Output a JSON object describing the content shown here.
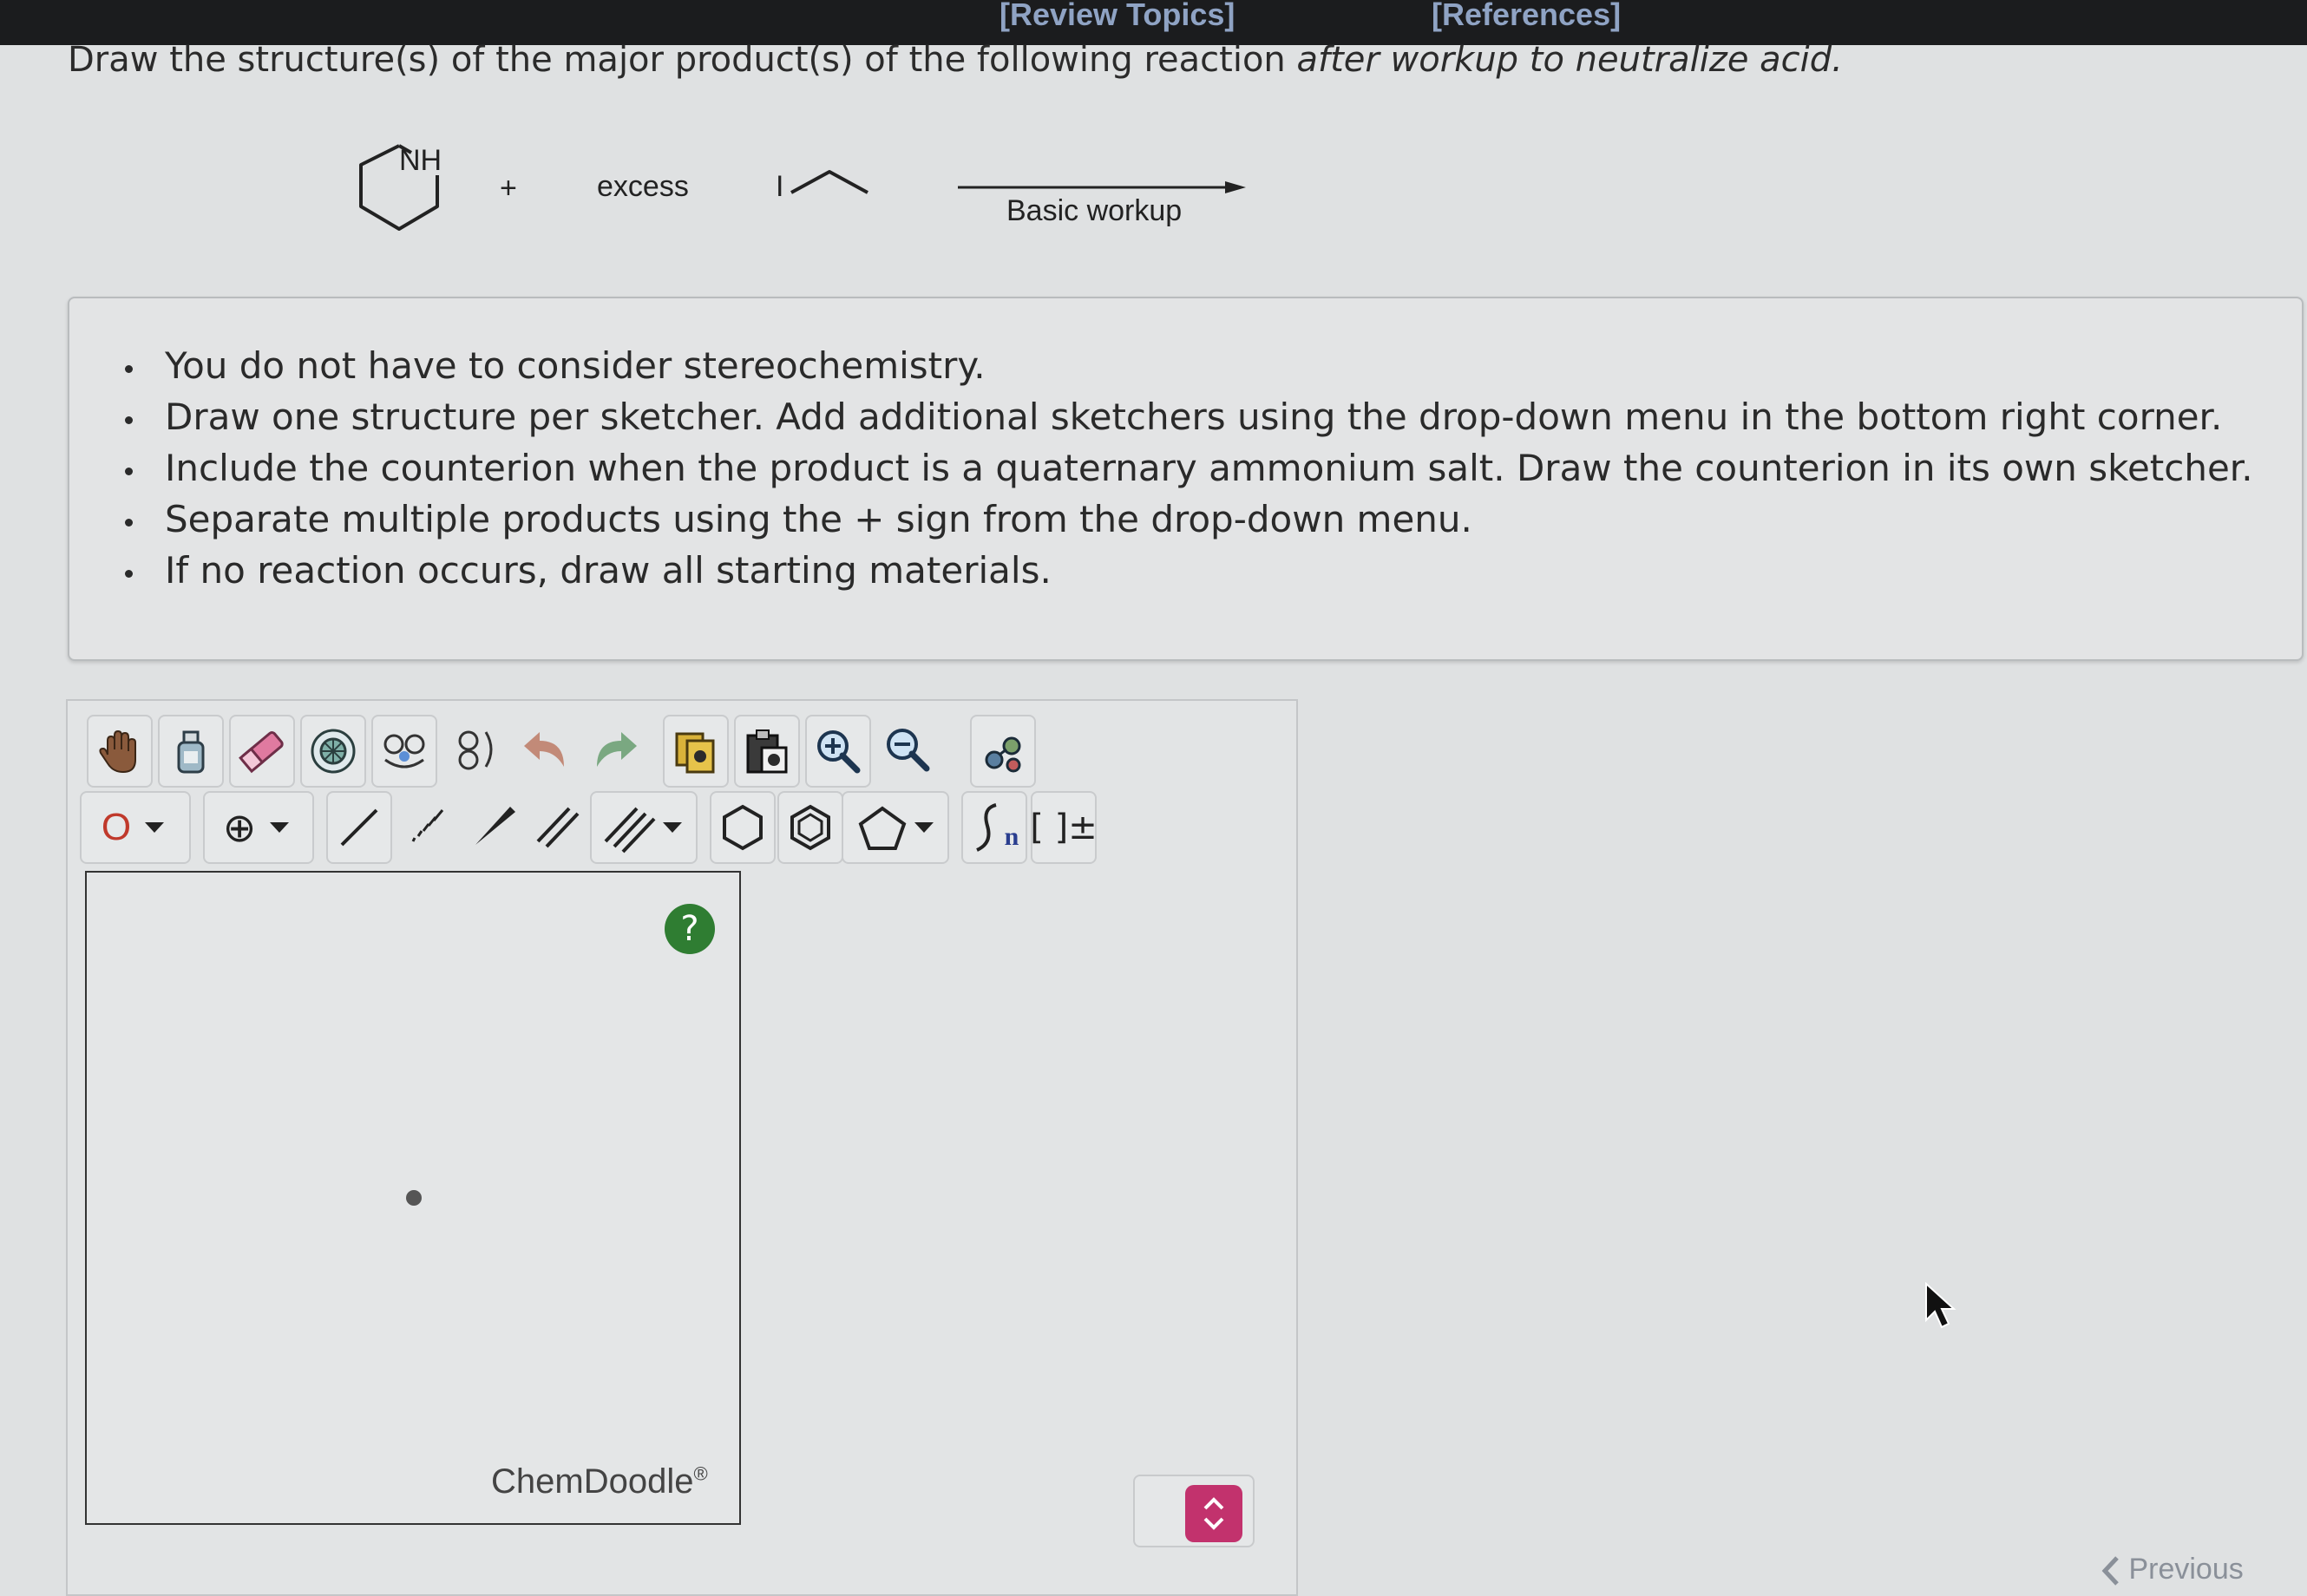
{
  "header": {
    "review_topics": "[Review Topics]",
    "references": "[References]"
  },
  "question": {
    "part1": "Draw the structure(s) of the major product(s) of the following reaction ",
    "part2_italic": "after workup to neutralize acid."
  },
  "reaction": {
    "reactant_label": "NH",
    "plus": "+",
    "excess": "excess",
    "reagent_atom": "I",
    "arrow_condition": "Basic workup"
  },
  "instructions": [
    "You do not have to consider stereochemistry.",
    "Draw one structure per sketcher. Add additional sketchers using the drop-down menu in the bottom right corner.",
    "Include the counterion when the product is a quaternary ammonium salt. Draw the counterion in its own sketcher.",
    "Separate multiple products using the + sign from the drop-down menu.",
    "If no reaction occurs, draw all starting materials."
  ],
  "toolbar": {
    "row1": [
      "hand-icon",
      "clear-bottle-icon",
      "eraser-icon",
      "center-ring-icon",
      "template-icon",
      "rotate-template-icon",
      "undo-icon",
      "redo-icon",
      "copy-icon",
      "paste-icon",
      "zoom-in-icon",
      "zoom-out-icon",
      "cleanup-icon"
    ],
    "atom_label": "O",
    "charge_label": "⊕",
    "polymer_label": "n",
    "bracket_label": "[ ]±"
  },
  "sketcher": {
    "help": "?",
    "brand": "ChemDoodle",
    "brand_mark": "®"
  },
  "footer": {
    "previous": "Previous"
  },
  "colors": {
    "topbar": "#1b1c1e",
    "link": "#8fa3c4",
    "help_button": "#2f7d32",
    "stepper_button": "#c2326d",
    "atom_o": "#c0392b"
  }
}
